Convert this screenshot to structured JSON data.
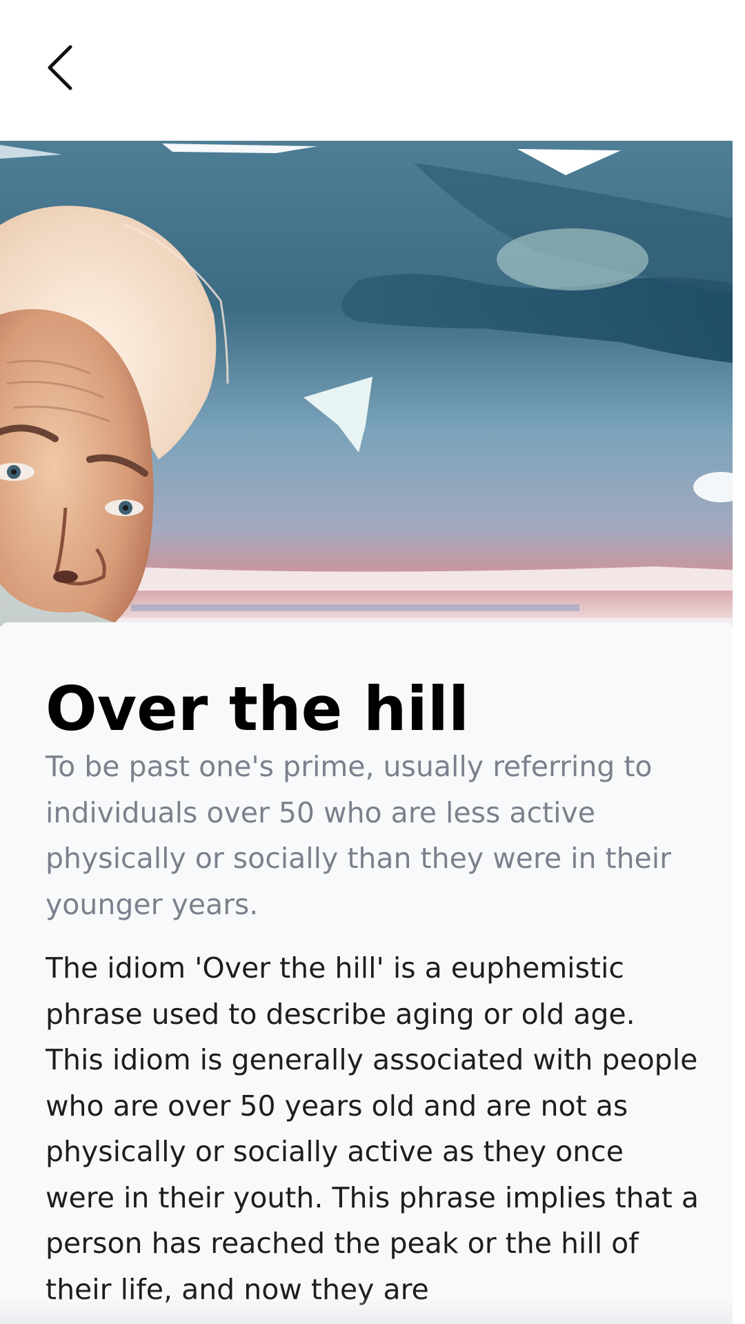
{
  "navigation": {
    "back_icon": "chevron-left-icon"
  },
  "hero": {
    "image": "watercolor-illustration-elderly-man",
    "colors": {
      "sky_dark": "#3f6e86",
      "sky_mid": "#6f9ab2",
      "sky_light": "#a9c6d6",
      "sunset": "#c98a90",
      "hair": "#f1dcc8"
    }
  },
  "idiom": {
    "title": "Over the hill",
    "definition": "To be past one's prime, usually referring to individuals over 50 who are less active physically or socially than they were in their younger years.",
    "explanation": "The idiom 'Over the hill' is a euphemistic phrase used to describe aging or old age. This idiom is generally associated with people who are over 50 years old and are not as physically or socially active as they once were in their youth. This phrase implies that a person has reached the peak or the hill of their life, and now they are"
  },
  "colors": {
    "card_background": "#f8f9fb",
    "title": "#000000",
    "definition": "#7b808c",
    "body": "#1d1d1f"
  }
}
